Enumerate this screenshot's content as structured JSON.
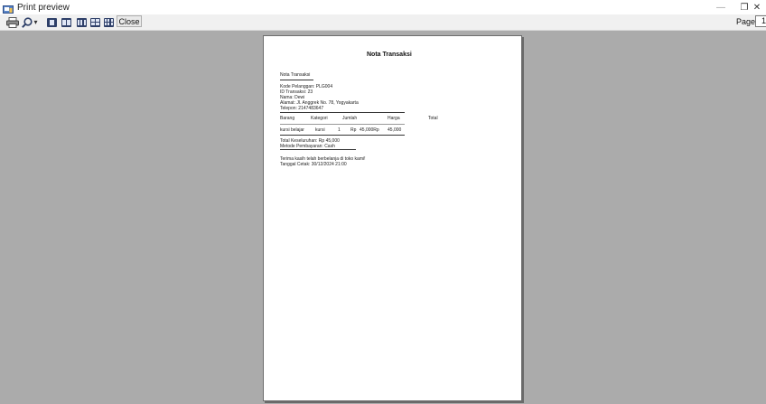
{
  "window": {
    "title": "Print preview",
    "controls": {
      "minimize": "—",
      "maximize": "❐",
      "close": "✕"
    }
  },
  "toolbar": {
    "icons": [
      "printer-icon",
      "magnifier-icon",
      "one-page-icon",
      "two-pages-icon",
      "three-pages-icon",
      "four-pages-icon",
      "six-pages-icon"
    ],
    "zoom_dropdown_glyph": "▾",
    "close_label": "Close",
    "page_label": "Page",
    "page_value": "1"
  },
  "document": {
    "heading": "Nota Transaksi",
    "section_title": "Nota Transaksi",
    "customer": {
      "kode_pelanggan": "Kode Pelanggan: PLG004",
      "id_transaksi": "ID Transaksi: 23",
      "nama": "Nama: Dewi",
      "alamat": "Alamat: Jl. Anggrek No. 78, Yogyakarta",
      "telepon": "Telepon: 2147483647"
    },
    "table": {
      "headers": [
        "Barang",
        "Kategori",
        "Jumlah",
        "Harga",
        "Total"
      ],
      "rows": [
        [
          "kursi belajar",
          "kursi",
          "1",
          "Rp",
          "45,000Rp",
          "45,000"
        ]
      ]
    },
    "total": "Total Keseluruhan: Rp 45,000",
    "payment": "Metode Pembayaran: Cash",
    "thanks": "Terima kasih telah berbelanja di toko kami!",
    "print_date": "Tanggal Cetak: 30/12/2024 21:00"
  },
  "colors": {
    "titlebar": "#ffffff",
    "toolbar": "#f0f0f0",
    "preview_background": "#ababab",
    "page_icon": "#2e3f68"
  }
}
